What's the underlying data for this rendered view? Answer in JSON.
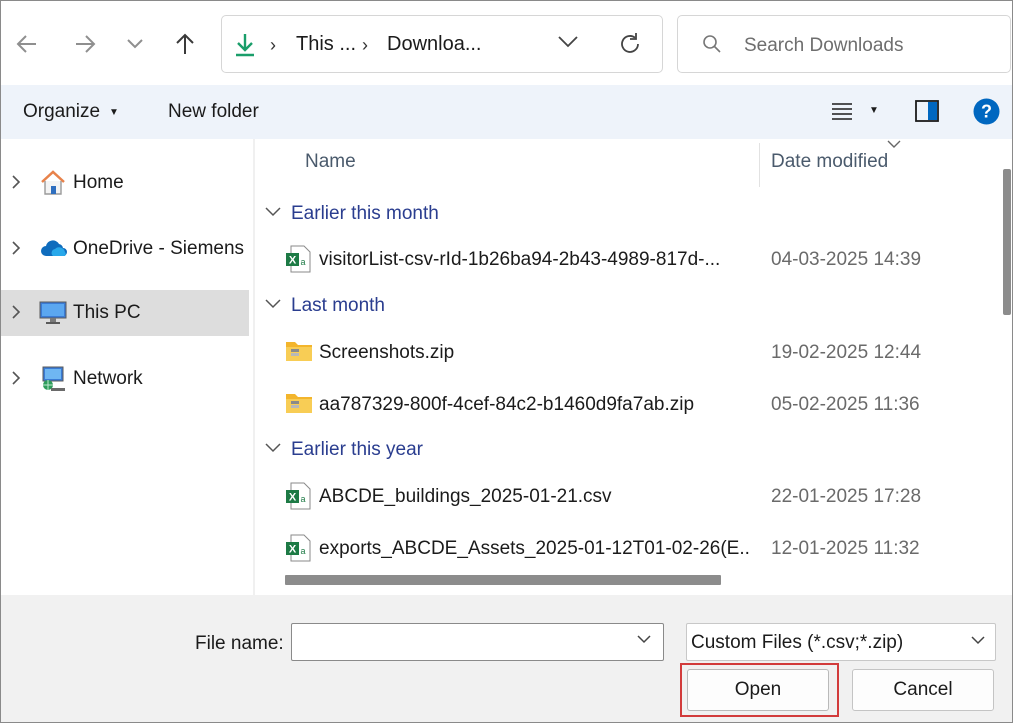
{
  "address": {
    "crumbs": [
      "This ...",
      "Downloa..."
    ]
  },
  "search": {
    "placeholder": "Search Downloads"
  },
  "toolbar": {
    "organize_label": "Organize",
    "new_folder_label": "New folder"
  },
  "nav": {
    "items": [
      {
        "label": "Home",
        "icon": "home-icon"
      },
      {
        "label": "OneDrive - Siemens",
        "icon": "onedrive-cloud-icon"
      },
      {
        "label": "This PC",
        "icon": "computer-icon",
        "selected": true
      },
      {
        "label": "Network",
        "icon": "network-icon"
      }
    ]
  },
  "columns": {
    "name": "Name",
    "date_modified": "Date modified"
  },
  "groups": [
    {
      "label": "Earlier this month",
      "files": [
        {
          "name": "visitorList-csv-rId-1b26ba94-2b43-4989-817d-...",
          "date": "04-03-2025 14:39",
          "icon": "excel-csv-icon"
        }
      ]
    },
    {
      "label": "Last month",
      "files": [
        {
          "name": "Screenshots.zip",
          "date": "19-02-2025 12:44",
          "icon": "zip-folder-icon"
        },
        {
          "name": "aa787329-800f-4cef-84c2-b1460d9fa7ab.zip",
          "date": "05-02-2025 11:36",
          "icon": "zip-folder-icon"
        }
      ]
    },
    {
      "label": "Earlier this year",
      "files": [
        {
          "name": "ABCDE_buildings_2025-01-21.csv",
          "date": "22-01-2025 17:28",
          "icon": "excel-csv-icon"
        },
        {
          "name": "exports_ABCDE_Assets_2025-01-12T01-02-26(E...",
          "date": "12-01-2025 11:32",
          "icon": "excel-csv-icon"
        }
      ]
    }
  ],
  "bottom": {
    "file_name_label": "File name:",
    "file_name_value": "",
    "filter_value": "Custom Files (*.csv;*.zip)",
    "open_label": "Open",
    "cancel_label": "Cancel"
  },
  "colors": {
    "accent": "#0067c0",
    "group_header": "#2a3d8f",
    "download_green": "#1a9e6a",
    "highlight_red": "#d23b3b",
    "toolbar_bg": "#eef3fa"
  }
}
